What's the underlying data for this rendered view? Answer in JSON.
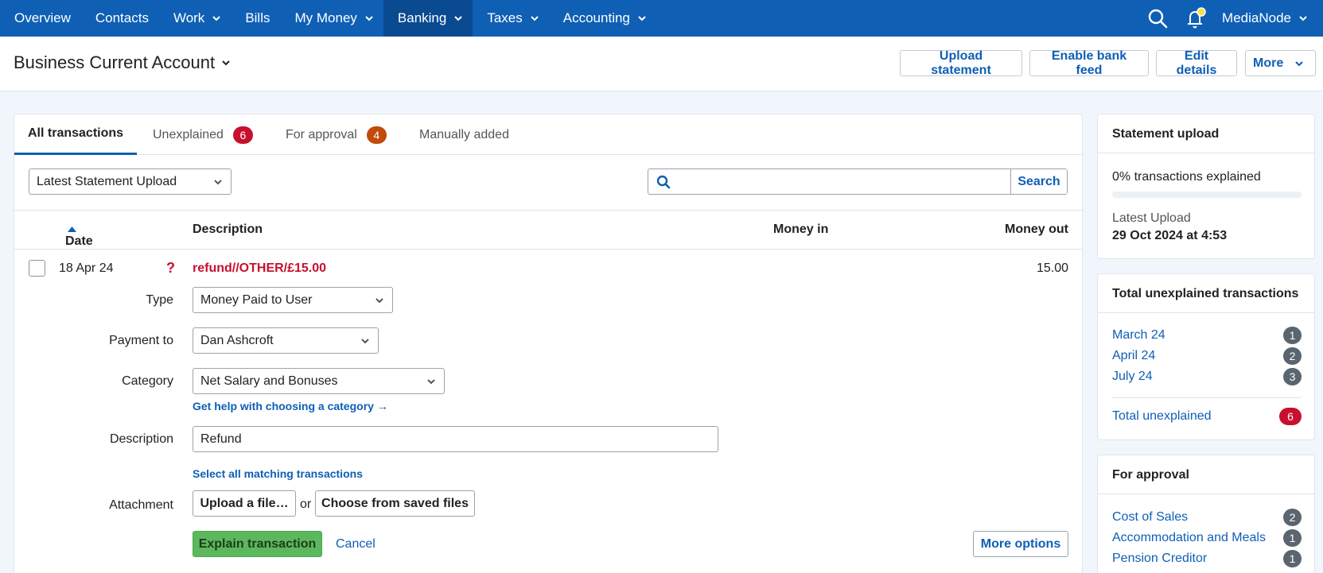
{
  "nav": {
    "items": [
      {
        "label": "Overview",
        "dropdown": false
      },
      {
        "label": "Contacts",
        "dropdown": false
      },
      {
        "label": "Work",
        "dropdown": true
      },
      {
        "label": "Bills",
        "dropdown": false
      },
      {
        "label": "My Money",
        "dropdown": true
      },
      {
        "label": "Banking",
        "dropdown": true,
        "active": true
      },
      {
        "label": "Taxes",
        "dropdown": true
      },
      {
        "label": "Accounting",
        "dropdown": true
      }
    ],
    "user": "MediaNode",
    "icons": [
      "search-icon",
      "bell-icon"
    ]
  },
  "header": {
    "title": "Business Current Account",
    "buttons": {
      "upload": "Upload statement",
      "feed": "Enable bank feed",
      "edit": "Edit details",
      "more": "More"
    }
  },
  "tabs": {
    "all": "All transactions",
    "unexplained": "Unexplained",
    "unexplained_count": "6",
    "approval": "For approval",
    "approval_count": "4",
    "manual": "Manually added"
  },
  "filter": {
    "selected": "Latest Statement Upload"
  },
  "search": {
    "button": "Search",
    "placeholder": ""
  },
  "table": {
    "headers": {
      "date": "Date",
      "description": "Description",
      "money_in": "Money in",
      "money_out": "Money out"
    }
  },
  "transaction": {
    "date": "18 Apr 24",
    "status_icon": "?",
    "description": "refund//OTHER/£15.00",
    "money_out": "15.00",
    "form": {
      "type_label": "Type",
      "type_value": "Money Paid to User",
      "payment_label": "Payment to",
      "payment_value": "Dan Ashcroft",
      "category_label": "Category",
      "category_value": "Net Salary and Bonuses",
      "category_help": "Get help with choosing a category →",
      "description_label": "Description",
      "description_value": "Refund",
      "select_matching": "Select all matching transactions",
      "attachment_label": "Attachment",
      "upload_file": "Upload a file…",
      "or": "or",
      "choose_saved": "Choose from saved files",
      "explain": "Explain transaction",
      "cancel": "Cancel",
      "more_options": "More options"
    }
  },
  "sidebar": {
    "statement": {
      "title": "Statement upload",
      "explained_text": "0% transactions explained",
      "explained_percent": 0,
      "latest_label": "Latest Upload",
      "latest_value": "29 Oct 2024 at 4:53"
    },
    "unexplained": {
      "title": "Total unexplained transactions",
      "items": [
        {
          "label": "March 24",
          "count": "1"
        },
        {
          "label": "April 24",
          "count": "2"
        },
        {
          "label": "July 24",
          "count": "3"
        }
      ],
      "total_label": "Total unexplained",
      "total_count": "6"
    },
    "approval": {
      "title": "For approval",
      "items": [
        {
          "label": "Cost of Sales",
          "count": "2"
        },
        {
          "label": "Accommodation and Meals",
          "count": "1"
        },
        {
          "label": "Pension Creditor",
          "count": "1"
        }
      ]
    }
  },
  "colors": {
    "brand": "#0f5fb5",
    "alert": "#c8102e",
    "success": "#5cb85c"
  }
}
